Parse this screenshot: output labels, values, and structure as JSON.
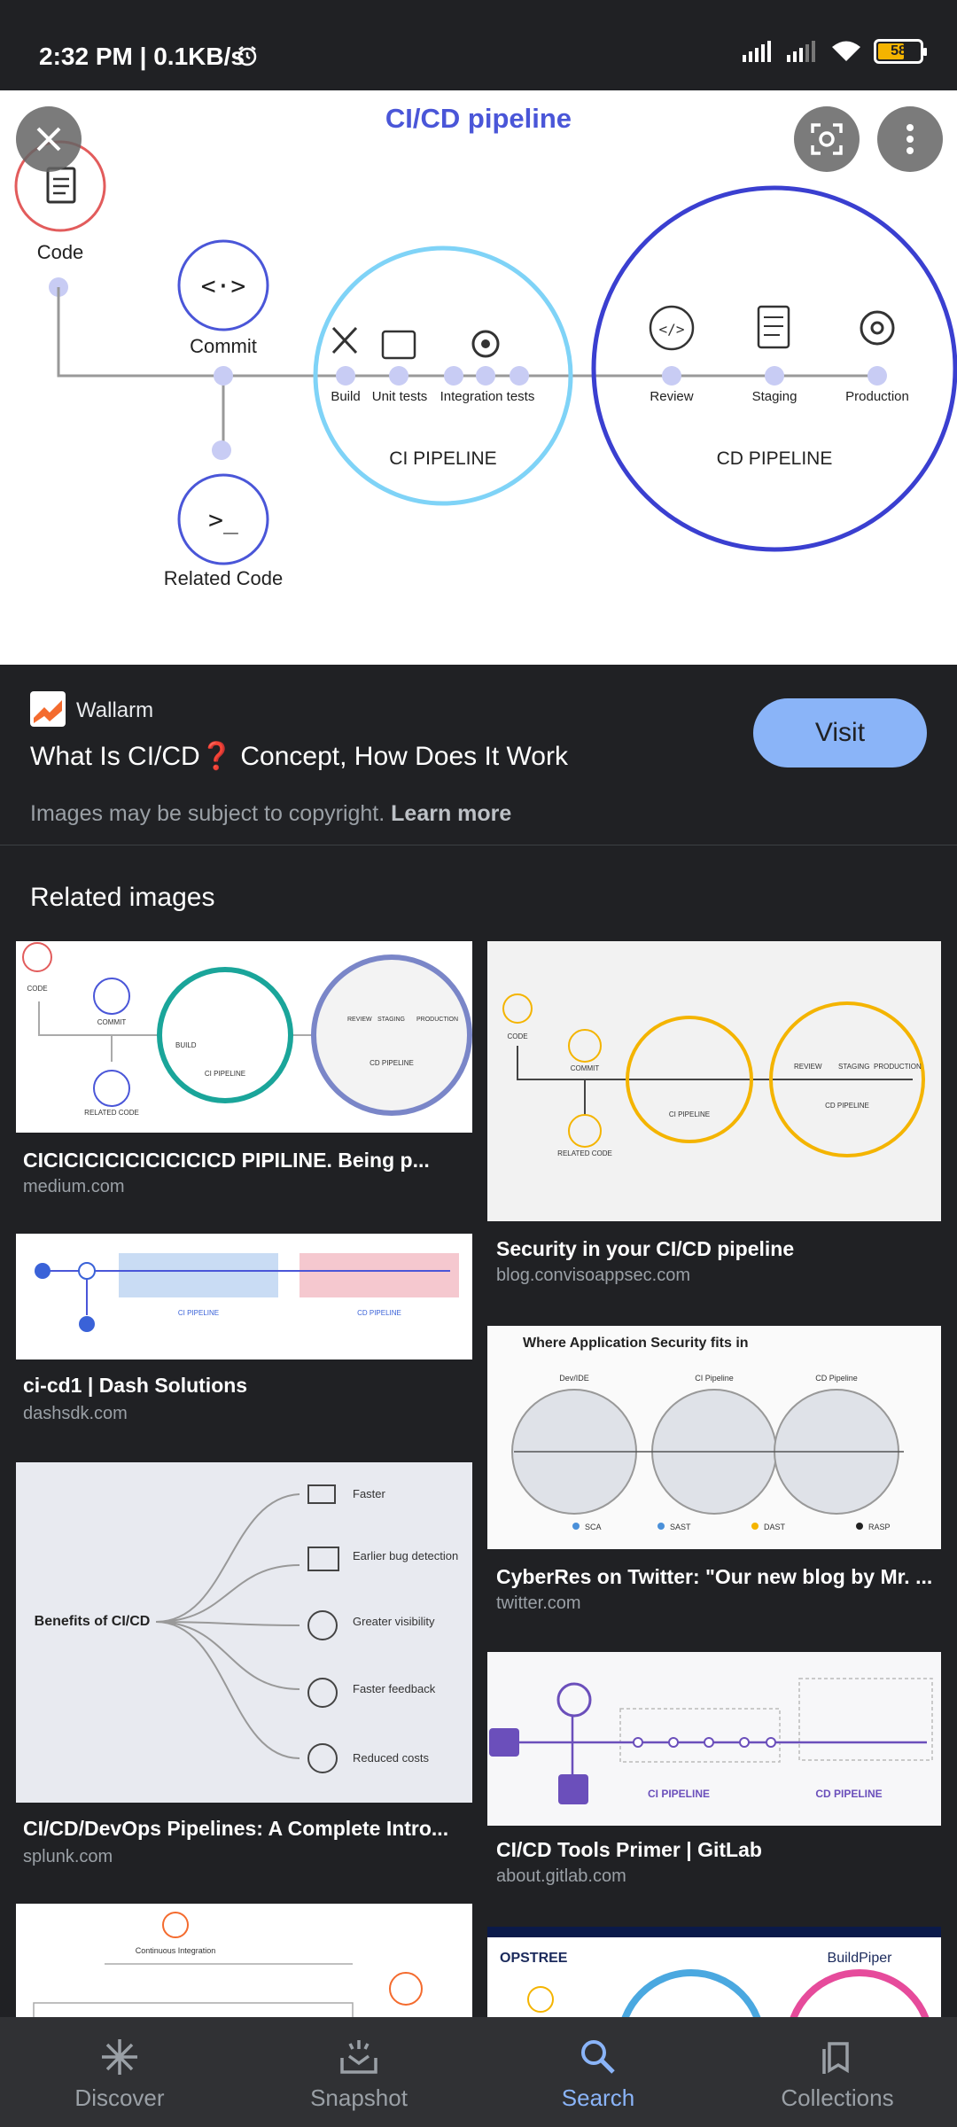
{
  "status_bar": {
    "time": "2:32 PM | 0.1KB/s",
    "battery": "58"
  },
  "hero": {
    "title": "CI/CD pipeline",
    "code": "Code",
    "commit": "Commit",
    "related_code": "Related Code",
    "build": "Build",
    "unit_tests": "Unit tests",
    "integration_tests": "Integration tests",
    "ci_pipeline": "CI PIPELINE",
    "review": "Review",
    "staging": "Staging",
    "production": "Production",
    "cd_pipeline": "CD PIPELINE"
  },
  "source": {
    "site": "Wallarm",
    "title": "What Is CI/CD❓ Concept, How Does It Work",
    "visit_label": "Visit",
    "copyright": "Images may be subject to copyright.",
    "learn_more": "Learn more"
  },
  "related": {
    "heading": "Related images",
    "items": [
      {
        "title": "CICICICICICICICICICD PIPILINE. Being p...",
        "domain": "medium.com"
      },
      {
        "title": "Security in your CI/CD pipeline",
        "domain": "blog.convisoappsec.com"
      },
      {
        "title": "ci-cd1 | Dash Solutions",
        "domain": "dashsdk.com"
      },
      {
        "title": "CyberRes on Twitter: \"Our new blog by Mr. ...",
        "domain": "twitter.com"
      },
      {
        "title": "CI/CD/DevOps Pipelines: A Complete Intro...",
        "domain": "splunk.com"
      },
      {
        "title": "CI/CD Tools Primer | GitLab",
        "domain": "about.gitlab.com"
      }
    ],
    "thumb_text": {
      "code": "CODE",
      "commit": "COMMIT",
      "related_code": "RELATED CODE",
      "build": "BUILD",
      "unit_test": "UNIT TESTS",
      "integration": "INTEGRATION TESTS",
      "ci": "CI PIPELINE",
      "cd": "CD PIPELINE",
      "review": "REVIEW",
      "staging": "STAGING",
      "production": "PRODUCTION",
      "where_sec": "Where Application Security fits in",
      "devide": "Dev/IDE",
      "ci_pipeline": "CI Pipeline",
      "cd_pipeline": "CD Pipeline",
      "sca": "SCA",
      "sast": "SAST",
      "dast": "DAST",
      "rasp": "RASP",
      "benefits": "Benefits of CI/CD",
      "faster": "Faster",
      "earlier_bug": "Earlier bug detection",
      "greater_vis": "Greater visibility",
      "faster_feedback": "Faster feedback",
      "reduced_costs": "Reduced costs",
      "gitlab_ci": "CI PIPELINE",
      "gitlab_cd": "CD PIPELINE",
      "continuous_integration": "Continuous Integration",
      "opstree": "OPSTREE",
      "buildpiper": "BuildPiper"
    }
  },
  "nav": [
    {
      "label": "Discover",
      "icon": "asterisk-icon"
    },
    {
      "label": "Snapshot",
      "icon": "snapshot-icon"
    },
    {
      "label": "Search",
      "icon": "search-icon"
    },
    {
      "label": "Collections",
      "icon": "collections-icon"
    }
  ],
  "colors": {
    "accent": "#8ab4f8",
    "ci_circle": "#7fd3f7",
    "cd_circle": "#3a3fd0",
    "code_circle": "#e25c5c"
  }
}
